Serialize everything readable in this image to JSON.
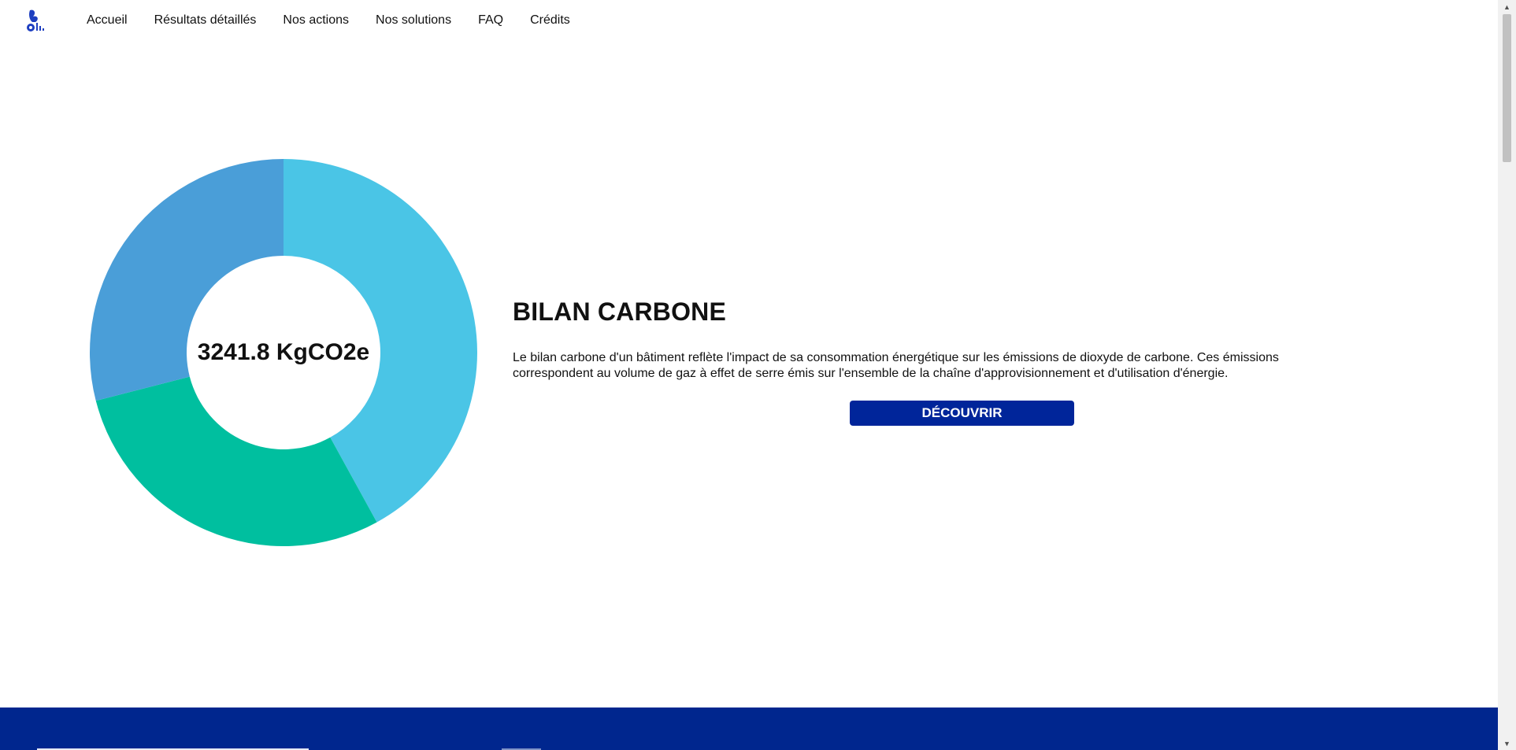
{
  "nav": {
    "logo_icon": "building-leaf-logo-icon",
    "items": [
      "Accueil",
      "Résultats détaillés",
      "Nos actions",
      "Nos solutions",
      "FAQ",
      "Crédits"
    ]
  },
  "chart_data": {
    "type": "pie",
    "donut": true,
    "center_label": "3241.8 KgCO2e",
    "slices": [
      {
        "value": 42,
        "color": "#4AC5E6"
      },
      {
        "value": 29,
        "color": "#00BF9F"
      },
      {
        "value": 29,
        "color": "#4A9ED8"
      }
    ]
  },
  "info": {
    "title": "BILAN CARBONE",
    "text": "Le bilan carbone d'un bâtiment reflète l'impact de sa consommation énergétique sur les émissions de dioxyde de carbone. Ces émissions correspondent au volume de gaz à effet de serre émis sur l'ensemble de la chaîne d'approvisionnement et d'utilisation d'énergie.",
    "button_label": "DÉCOUVRIR"
  },
  "colors": {
    "accent": "#00259A",
    "footer": "#00268E"
  },
  "scrollbar": {
    "up_icon": "▲",
    "down_icon": "▼"
  }
}
